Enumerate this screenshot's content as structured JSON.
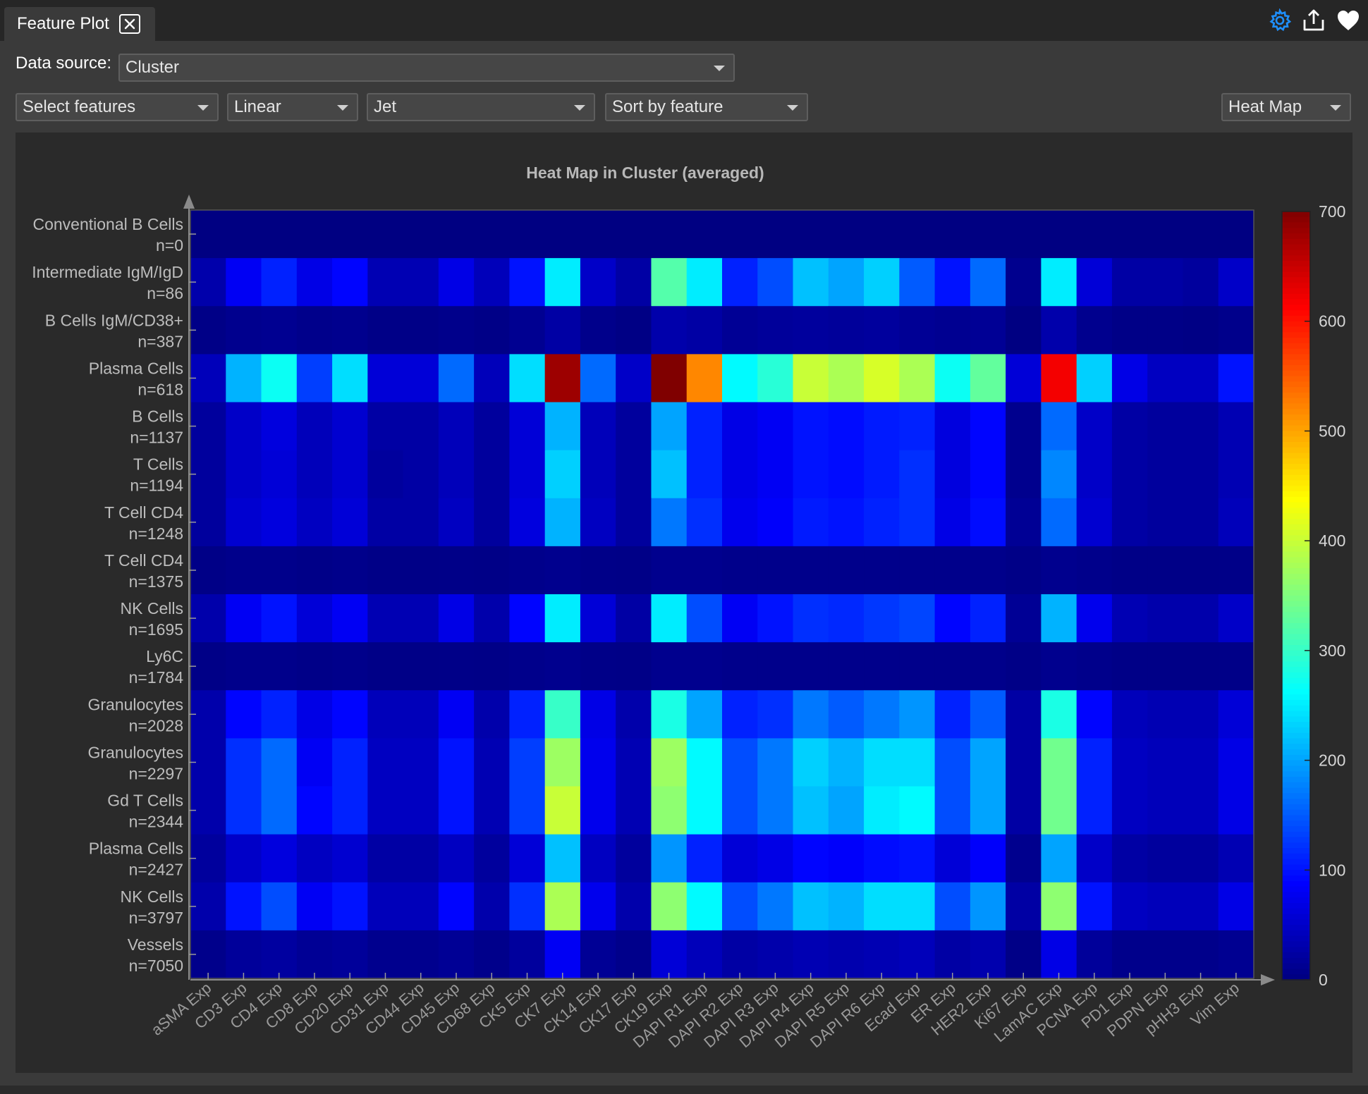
{
  "tab": {
    "title": "Feature Plot",
    "close_icon": "close-icon"
  },
  "toolbar_icons": [
    "gear-icon",
    "export-icon",
    "heart-icon"
  ],
  "accent_color": "#1e90ff",
  "data_source": {
    "label": "Data source:",
    "value": "Cluster"
  },
  "controls": {
    "features": "Select features",
    "scale": "Linear",
    "colormap": "Jet",
    "sort": "Sort by feature",
    "plot_type": "Heat Map"
  },
  "chart_data": {
    "type": "heatmap",
    "title": "Heat Map in Cluster (averaged)",
    "colormap": "jet",
    "zlim": [
      0,
      700
    ],
    "colorbar_ticks": [
      0,
      100,
      200,
      300,
      400,
      500,
      600,
      700
    ],
    "columns": [
      "aSMA Exp",
      "CD3 Exp",
      "CD4 Exp",
      "CD8 Exp",
      "CD20 Exp",
      "CD31 Exp",
      "CD44 Exp",
      "CD45 Exp",
      "CD68 Exp",
      "CK5 Exp",
      "CK7 Exp",
      "CK14 Exp",
      "CK17 Exp",
      "CK19 Exp",
      "DAPI R1 Exp",
      "DAPI R2 Exp",
      "DAPI R3 Exp",
      "DAPI R4 Exp",
      "DAPI R5 Exp",
      "DAPI R6 Exp",
      "Ecad Exp",
      "ER Exp",
      "HER2 Exp",
      "Ki67 Exp",
      "LamAC Exp",
      "PCNA Exp",
      "PD1 Exp",
      "PDPN Exp",
      "pHH3 Exp",
      "Vim Exp"
    ],
    "rows": [
      {
        "name": "Conventional B Cells",
        "n": "n=0"
      },
      {
        "name": "Intermediate IgM/IgD",
        "n": "n=86"
      },
      {
        "name": "B Cells IgM/CD38+",
        "n": "n=387"
      },
      {
        "name": "Plasma Cells",
        "n": "n=618"
      },
      {
        "name": "B Cells",
        "n": "n=1137"
      },
      {
        "name": "T Cells",
        "n": "n=1194"
      },
      {
        "name": "T Cell CD4",
        "n": "n=1248"
      },
      {
        "name": "T Cell CD4",
        "n": "n=1375"
      },
      {
        "name": "NK Cells",
        "n": "n=1695"
      },
      {
        "name": "Ly6C",
        "n": "n=1784"
      },
      {
        "name": "Granulocytes",
        "n": "n=2028"
      },
      {
        "name": "Granulocytes",
        "n": "n=2297"
      },
      {
        "name": "Gd T Cells",
        "n": "n=2344"
      },
      {
        "name": "Plasma Cells",
        "n": "n=2427"
      },
      {
        "name": "NK Cells",
        "n": "n=3797"
      },
      {
        "name": "Vessels",
        "n": "n=7050"
      }
    ],
    "values": [
      [
        2,
        2,
        2,
        2,
        2,
        2,
        2,
        2,
        2,
        2,
        2,
        2,
        2,
        2,
        2,
        2,
        2,
        2,
        2,
        2,
        2,
        2,
        2,
        2,
        2,
        2,
        2,
        2,
        2,
        2
      ],
      [
        30,
        80,
        110,
        70,
        90,
        35,
        35,
        70,
        40,
        100,
        250,
        50,
        25,
        320,
        250,
        110,
        140,
        220,
        200,
        230,
        150,
        100,
        160,
        10,
        250,
        60,
        25,
        25,
        20,
        50
      ],
      [
        5,
        10,
        12,
        8,
        10,
        5,
        5,
        8,
        5,
        12,
        25,
        8,
        4,
        30,
        25,
        15,
        18,
        20,
        18,
        20,
        15,
        12,
        15,
        2,
        30,
        10,
        5,
        5,
        4,
        8
      ],
      [
        40,
        210,
        270,
        130,
        240,
        60,
        60,
        160,
        40,
        240,
        680,
        160,
        50,
        720,
        520,
        260,
        290,
        400,
        380,
        410,
        380,
        270,
        330,
        60,
        620,
        230,
        70,
        45,
        45,
        100
      ],
      [
        20,
        50,
        65,
        40,
        55,
        25,
        25,
        40,
        20,
        60,
        210,
        40,
        20,
        200,
        110,
        70,
        80,
        100,
        95,
        105,
        110,
        65,
        90,
        10,
        160,
        50,
        25,
        20,
        20,
        35
      ],
      [
        20,
        50,
        60,
        40,
        55,
        20,
        25,
        40,
        20,
        60,
        230,
        40,
        20,
        220,
        110,
        70,
        80,
        100,
        95,
        105,
        120,
        65,
        90,
        10,
        180,
        50,
        25,
        20,
        20,
        35
      ],
      [
        20,
        55,
        65,
        45,
        60,
        25,
        25,
        45,
        20,
        65,
        210,
        45,
        20,
        170,
        120,
        75,
        85,
        105,
        100,
        110,
        120,
        70,
        95,
        15,
        160,
        55,
        25,
        20,
        20,
        40
      ],
      [
        5,
        8,
        8,
        6,
        8,
        5,
        5,
        6,
        5,
        8,
        10,
        6,
        5,
        10,
        10,
        8,
        8,
        8,
        8,
        8,
        8,
        8,
        8,
        5,
        10,
        8,
        5,
        5,
        5,
        6
      ],
      [
        30,
        80,
        100,
        60,
        80,
        35,
        35,
        70,
        30,
        90,
        250,
        60,
        25,
        250,
        140,
        80,
        100,
        120,
        115,
        125,
        135,
        90,
        110,
        15,
        210,
        75,
        35,
        30,
        30,
        50
      ],
      [
        5,
        8,
        8,
        6,
        8,
        5,
        5,
        6,
        5,
        8,
        10,
        6,
        5,
        10,
        10,
        8,
        8,
        8,
        8,
        8,
        8,
        8,
        8,
        5,
        10,
        8,
        5,
        5,
        5,
        6
      ],
      [
        30,
        90,
        110,
        70,
        90,
        40,
        40,
        80,
        30,
        110,
        300,
        70,
        30,
        280,
        200,
        110,
        120,
        170,
        150,
        170,
        190,
        110,
        150,
        25,
        280,
        90,
        40,
        35,
        35,
        60
      ],
      [
        30,
        120,
        160,
        80,
        110,
        45,
        45,
        100,
        35,
        130,
        370,
        75,
        35,
        370,
        260,
        140,
        170,
        230,
        210,
        240,
        240,
        140,
        200,
        25,
        340,
        110,
        45,
        40,
        40,
        70
      ],
      [
        30,
        120,
        160,
        90,
        110,
        45,
        45,
        100,
        35,
        130,
        400,
        75,
        35,
        360,
        260,
        140,
        170,
        220,
        200,
        250,
        260,
        140,
        200,
        25,
        340,
        110,
        45,
        40,
        40,
        70
      ],
      [
        20,
        50,
        65,
        45,
        55,
        25,
        25,
        45,
        20,
        60,
        220,
        45,
        20,
        190,
        110,
        60,
        70,
        90,
        85,
        95,
        100,
        60,
        85,
        10,
        200,
        50,
        25,
        20,
        20,
        35
      ],
      [
        30,
        100,
        140,
        80,
        100,
        40,
        40,
        90,
        30,
        120,
        380,
        75,
        30,
        360,
        260,
        140,
        170,
        220,
        210,
        240,
        240,
        140,
        190,
        25,
        360,
        100,
        45,
        40,
        40,
        70
      ],
      [
        8,
        18,
        22,
        15,
        18,
        10,
        10,
        15,
        8,
        20,
        80,
        15,
        8,
        60,
        40,
        25,
        30,
        35,
        32,
        35,
        40,
        25,
        32,
        5,
        70,
        18,
        8,
        8,
        8,
        12
      ]
    ]
  }
}
